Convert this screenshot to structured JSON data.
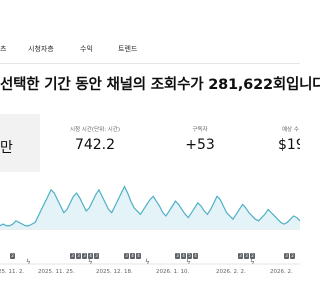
{
  "tabs": [
    {
      "label": "츠"
    },
    {
      "label": "시청자층"
    },
    {
      "label": "수익"
    },
    {
      "label": "트렌드"
    }
  ],
  "headline": "선택한 기간 동안 채널의 조회수가 281,622회입니다",
  "metrics": [
    {
      "label": "",
      "value": "만"
    },
    {
      "label": "시청 시간(단위: 시간)",
      "value": "742.2"
    },
    {
      "label": "구독자",
      "value": "+53"
    },
    {
      "label": "예상 수",
      "value": "$19"
    }
  ],
  "chart_data": {
    "type": "area",
    "x_tick_labels": [
      "25. 11. 2.",
      "2025. 11. 25.",
      "2025. 12. 18.",
      "2026. 1. 10.",
      "2026. 2. 2.",
      "2026. 2."
    ],
    "values": [
      2,
      3,
      2,
      2,
      3,
      5,
      4,
      3,
      2,
      2,
      3,
      4,
      8,
      12,
      16,
      20,
      24,
      22,
      18,
      14,
      10,
      12,
      16,
      20,
      22,
      19,
      15,
      11,
      13,
      17,
      21,
      24,
      20,
      16,
      12,
      10,
      14,
      18,
      22,
      26,
      22,
      17,
      13,
      11,
      9,
      12,
      15,
      18,
      20,
      17,
      14,
      10,
      8,
      11,
      14,
      17,
      15,
      12,
      9,
      7,
      10,
      13,
      16,
      14,
      11,
      9,
      12,
      16,
      20,
      18,
      14,
      10,
      8,
      6,
      9,
      12,
      15,
      13,
      10,
      8,
      6,
      5,
      7,
      9,
      12,
      10,
      8,
      6,
      4,
      3,
      4,
      6,
      8,
      7,
      5
    ],
    "ylim": [
      0,
      30
    ],
    "colors": {
      "line": "#4fb0c6",
      "fill": "#e4f3f7"
    }
  },
  "markers": {
    "groups": [
      {
        "x_index": 0,
        "items": [
          "2"
        ]
      },
      {
        "x_index": 1,
        "items": [
          "3",
          "3",
          "3",
          "4",
          "3"
        ]
      },
      {
        "x_index": 2,
        "items": [
          "3",
          "4",
          "4"
        ]
      },
      {
        "x_index": 3,
        "items": [
          "3",
          "4",
          "5",
          "4"
        ]
      },
      {
        "x_index": 4,
        "items": [
          "3",
          "3",
          "2"
        ]
      },
      {
        "x_index": 5,
        "items": [
          "3",
          "2"
        ]
      }
    ],
    "lightning_icon": "bolt-icon"
  }
}
